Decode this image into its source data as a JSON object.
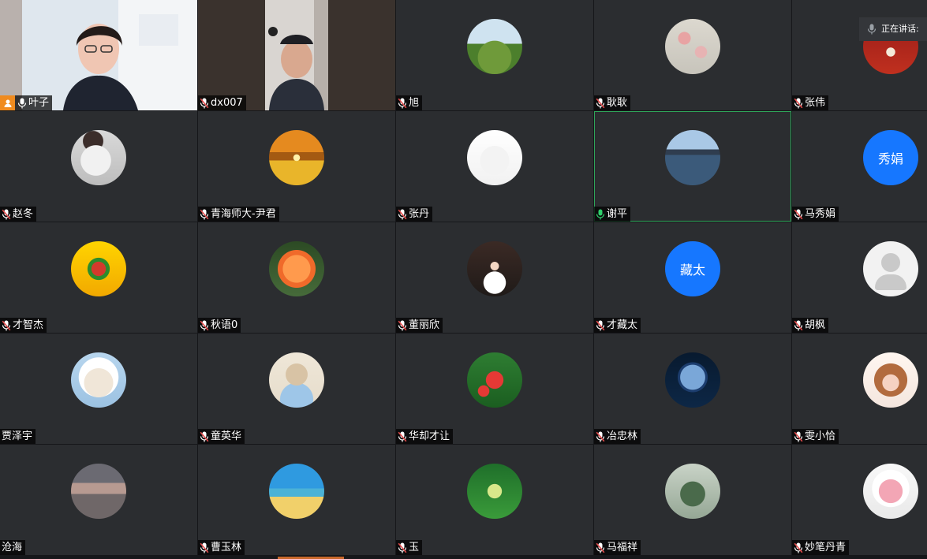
{
  "speaking_indicator": {
    "label": "正在讲话:"
  },
  "participants": [
    {
      "name": "叶子",
      "kind": "video-woman",
      "host": true,
      "mic": "on"
    },
    {
      "name": "dx007",
      "kind": "video-man",
      "mic": "muted"
    },
    {
      "name": "旭",
      "kind": "photo-trees",
      "mic": "muted"
    },
    {
      "name": "耿耿",
      "kind": "photo-flowers-gray",
      "mic": "muted"
    },
    {
      "name": "张伟",
      "kind": "photo-red-star",
      "mic": "muted"
    },
    {
      "name": "赵冬",
      "kind": "photo-white-doll",
      "mic": "muted"
    },
    {
      "name": "青海师大-尹君",
      "kind": "photo-sunflowers",
      "mic": "muted"
    },
    {
      "name": "张丹",
      "kind": "photo-cartoon-dog",
      "mic": "muted"
    },
    {
      "name": "谢平",
      "kind": "photo-river",
      "mic": "active",
      "active": true
    },
    {
      "name": "马秀娟",
      "kind": "text",
      "avatar_text": "秀娟",
      "mic": "muted"
    },
    {
      "name": "才智杰",
      "kind": "photo-yellow-art",
      "mic": "muted"
    },
    {
      "name": "秋语0",
      "kind": "photo-orange-flower",
      "mic": "muted"
    },
    {
      "name": "董丽欣",
      "kind": "photo-girl-stage",
      "mic": "muted"
    },
    {
      "name": "才藏太",
      "kind": "text",
      "avatar_text": "藏太",
      "mic": "muted"
    },
    {
      "name": "胡枫",
      "kind": "blank",
      "mic": "muted"
    },
    {
      "name": "贾泽宇",
      "kind": "photo-sheep-cartoon",
      "mic": "none"
    },
    {
      "name": "童英华",
      "kind": "photo-hat-girl",
      "mic": "muted"
    },
    {
      "name": "华却才让",
      "kind": "photo-red-symbol",
      "mic": "muted"
    },
    {
      "name": "冶忠林",
      "kind": "photo-earth",
      "mic": "muted"
    },
    {
      "name": "雯小恰",
      "kind": "photo-cartoon-girl",
      "mic": "muted"
    },
    {
      "name": "沧海",
      "kind": "photo-sea-dusk",
      "mic": "none"
    },
    {
      "name": "曹玉林",
      "kind": "photo-beach",
      "mic": "muted"
    },
    {
      "name": "玉",
      "kind": "photo-glass-butterfly",
      "mic": "muted"
    },
    {
      "name": "马福祥",
      "kind": "photo-leaves",
      "mic": "muted"
    },
    {
      "name": "妙笔丹青",
      "kind": "photo-pig-toy",
      "mic": "muted"
    }
  ],
  "colors": {
    "tile_bg": "#2b2d30",
    "avatar_blue": "#1677ff",
    "active_border": "#2fa65a",
    "host_badge": "#f08b1f",
    "muted_mic": "#e24b4b"
  }
}
